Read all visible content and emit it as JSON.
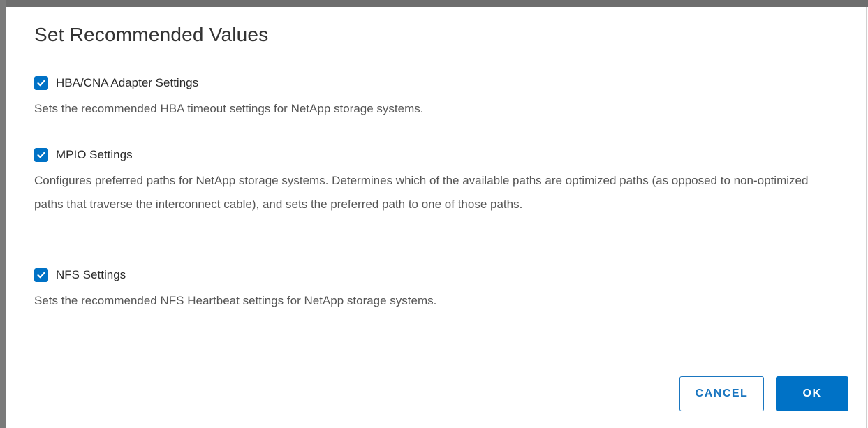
{
  "dialog": {
    "title": "Set Recommended Values",
    "options": [
      {
        "label": "HBA/CNA Adapter Settings",
        "checked": true,
        "description": "Sets the recommended HBA timeout settings for NetApp storage systems."
      },
      {
        "label": "MPIO Settings",
        "checked": true,
        "description": "Configures preferred paths for NetApp storage systems. Determines which of the available paths are optimized paths (as opposed to non-optimized paths that traverse the interconnect cable), and sets the preferred path to one of those paths."
      },
      {
        "label": "NFS Settings",
        "checked": true,
        "description": "Sets the recommended NFS Heartbeat settings for NetApp storage systems."
      }
    ],
    "buttons": {
      "cancel_label": "CANCEL",
      "ok_label": "OK"
    }
  },
  "colors": {
    "accent": "#0072c6",
    "text": "#333333",
    "description_text": "#555555"
  },
  "icons": {
    "checkbox_checked": "checkmark-icon"
  }
}
